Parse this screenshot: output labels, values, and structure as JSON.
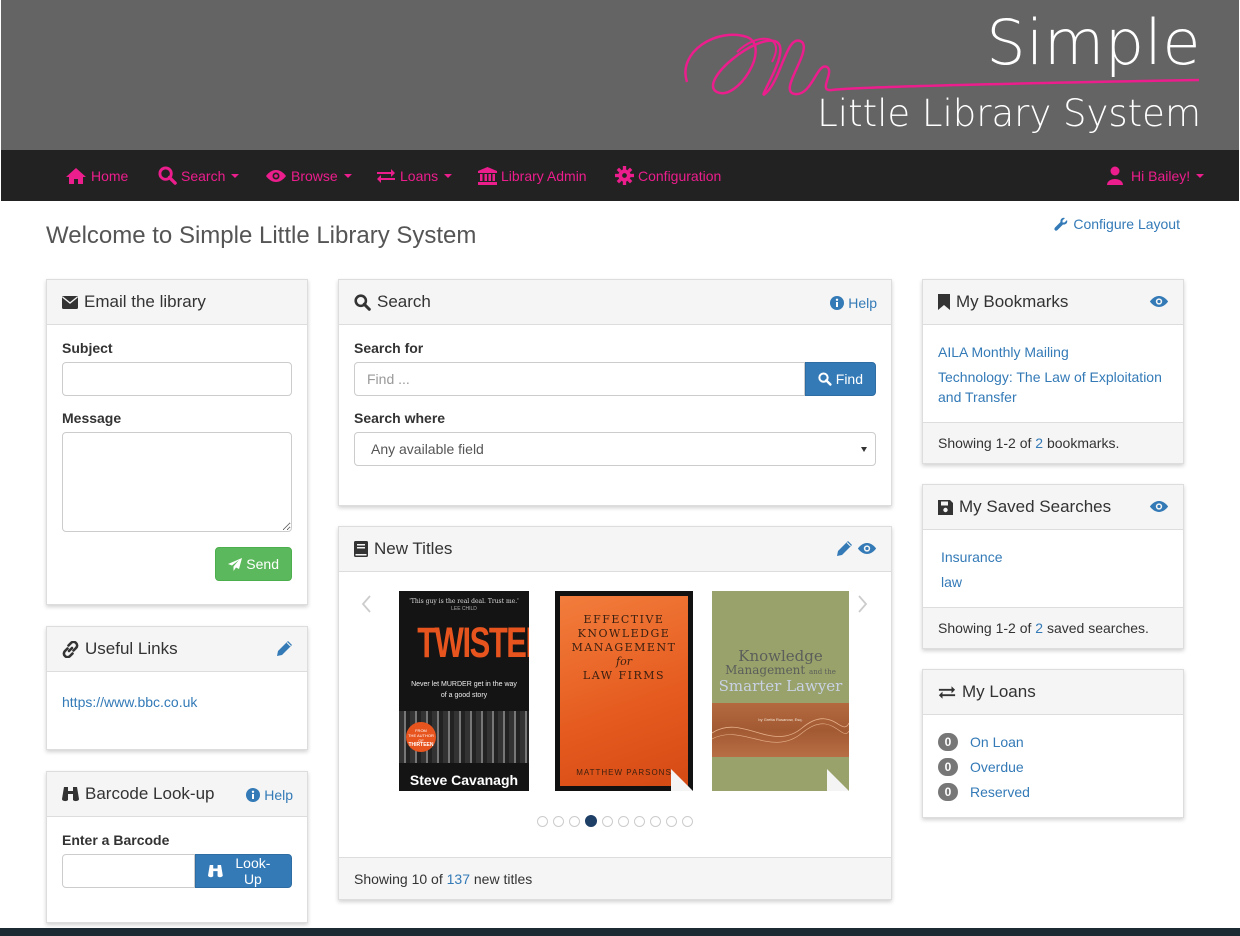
{
  "header": {
    "brand_line1": "Simple",
    "brand_line2": "Little Library System",
    "accent_color": "#ec1d8c"
  },
  "nav": {
    "home": "Home",
    "search": "Search",
    "browse": "Browse",
    "loans": "Loans",
    "library_admin": "Library Admin",
    "configuration": "Configuration",
    "user": "Hi Bailey!"
  },
  "page": {
    "title": "Welcome to Simple Little Library System",
    "configure_layout": "Configure Layout"
  },
  "email_panel": {
    "title": "Email the library",
    "subject_label": "Subject",
    "subject_value": "",
    "message_label": "Message",
    "message_value": "",
    "send_label": "Send"
  },
  "links_panel": {
    "title": "Useful Links",
    "links": [
      "https://www.bbc.co.uk"
    ]
  },
  "barcode_panel": {
    "title": "Barcode Look-up",
    "help_label": "Help",
    "input_label": "Enter a Barcode",
    "input_value": "",
    "lookup_label": "Look-Up"
  },
  "search_panel": {
    "title": "Search",
    "help_label": "Help",
    "search_for_label": "Search for",
    "search_placeholder": "Find ...",
    "find_label": "Find",
    "search_where_label": "Search where",
    "search_where_value": "Any available field"
  },
  "new_titles": {
    "title": "New Titles",
    "footer_prefix": "Showing 10 of ",
    "footer_count": "137",
    "footer_suffix": " new titles",
    "dot_count": 10,
    "active_dot": 4,
    "books": [
      {
        "tagline": "'This guy is the real deal. Trust me.'",
        "tagline_by": "LEE CHILD",
        "title": "TWISTED",
        "subtitle": "Never let MURDER get in the way of a good story",
        "badge1": "FROM",
        "badge2": "THE AUTHOR OF",
        "badge3": "THIRTEEN",
        "author": "Steve Cavanagh"
      },
      {
        "title_line1": "Effective",
        "title_line2": "Knowledge",
        "title_line3": "Management",
        "title_line4": "for",
        "title_line5": "Law Firms",
        "author": "Matthew Parsons"
      },
      {
        "title_line1": "Knowledge",
        "title_line2": "Management",
        "title_line2b": "and the",
        "title_line3": "Smarter Lawyer",
        "author": "by Gretta Rusanow, Esq."
      }
    ]
  },
  "bookmarks_panel": {
    "title": "My Bookmarks",
    "items": [
      "AILA Monthly Mailing",
      "Technology: The Law of Exploitation and Transfer"
    ],
    "footer_prefix": "Showing 1-2 of ",
    "footer_count": "2",
    "footer_suffix": " bookmarks."
  },
  "saved_searches_panel": {
    "title": "My Saved Searches",
    "items": [
      "Insurance",
      "law"
    ],
    "footer_prefix": "Showing 1-2 of ",
    "footer_count": "2",
    "footer_suffix": " saved searches."
  },
  "loans_panel": {
    "title": "My Loans",
    "items": [
      {
        "count": "0",
        "label": "On Loan"
      },
      {
        "count": "0",
        "label": "Overdue"
      },
      {
        "count": "0",
        "label": "Reserved"
      }
    ]
  }
}
